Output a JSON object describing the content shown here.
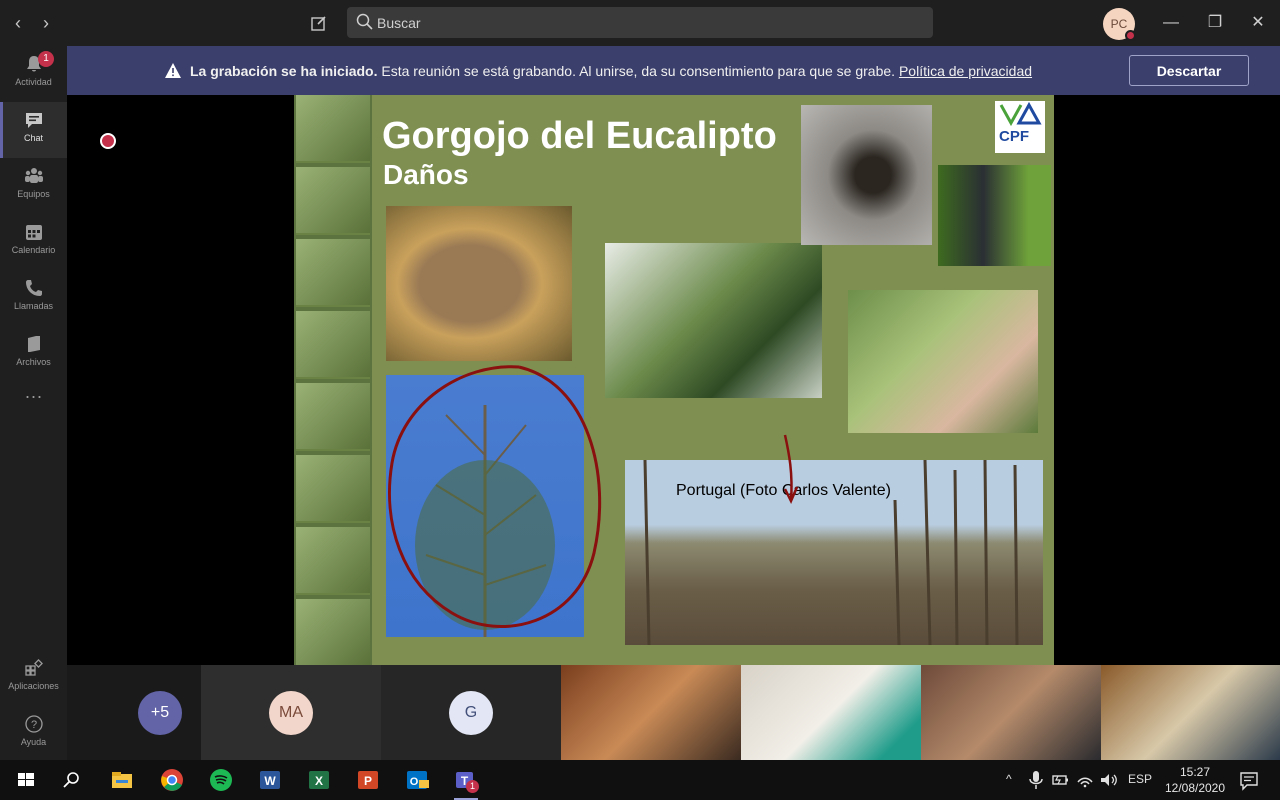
{
  "titlebar": {
    "search_placeholder": "Buscar",
    "avatar_initials": "PC"
  },
  "sidebar": {
    "items": [
      {
        "label": "Actividad",
        "badge": "1",
        "icon": "bell-icon"
      },
      {
        "label": "Chat",
        "icon": "chat-icon"
      },
      {
        "label": "Equipos",
        "icon": "teams-icon"
      },
      {
        "label": "Calendario",
        "icon": "calendar-icon"
      },
      {
        "label": "Llamadas",
        "icon": "phone-icon"
      },
      {
        "label": "Archivos",
        "icon": "file-icon"
      }
    ],
    "more": "···",
    "bottom_items": [
      {
        "label": "Aplicaciones",
        "icon": "apps-icon"
      },
      {
        "label": "Ayuda",
        "icon": "help-icon"
      }
    ]
  },
  "banner": {
    "bold_text": "La grabación se ha iniciado.",
    "text": "Esta reunión se está grabando. Al unirse, da su consentimiento para que se grabe.",
    "link": "Política de privacidad",
    "button": "Descartar"
  },
  "slide": {
    "title": "Gorgojo del Eucalipto",
    "subtitle": "Daños",
    "logo_text": "CPF",
    "photo_caption": "Portugal (Foto Carlos Valente)"
  },
  "participants": {
    "overflow": "+5",
    "initials_1": "MA",
    "initials_2": "G"
  },
  "taskbar": {
    "language": "ESP",
    "time": "15:27",
    "date": "12/08/2020",
    "teams_badge": "1"
  },
  "colors": {
    "accent": "#6264a7",
    "banner": "#3b3f6b",
    "record": "#c4314b",
    "slide_bg": "#7f8f52"
  }
}
